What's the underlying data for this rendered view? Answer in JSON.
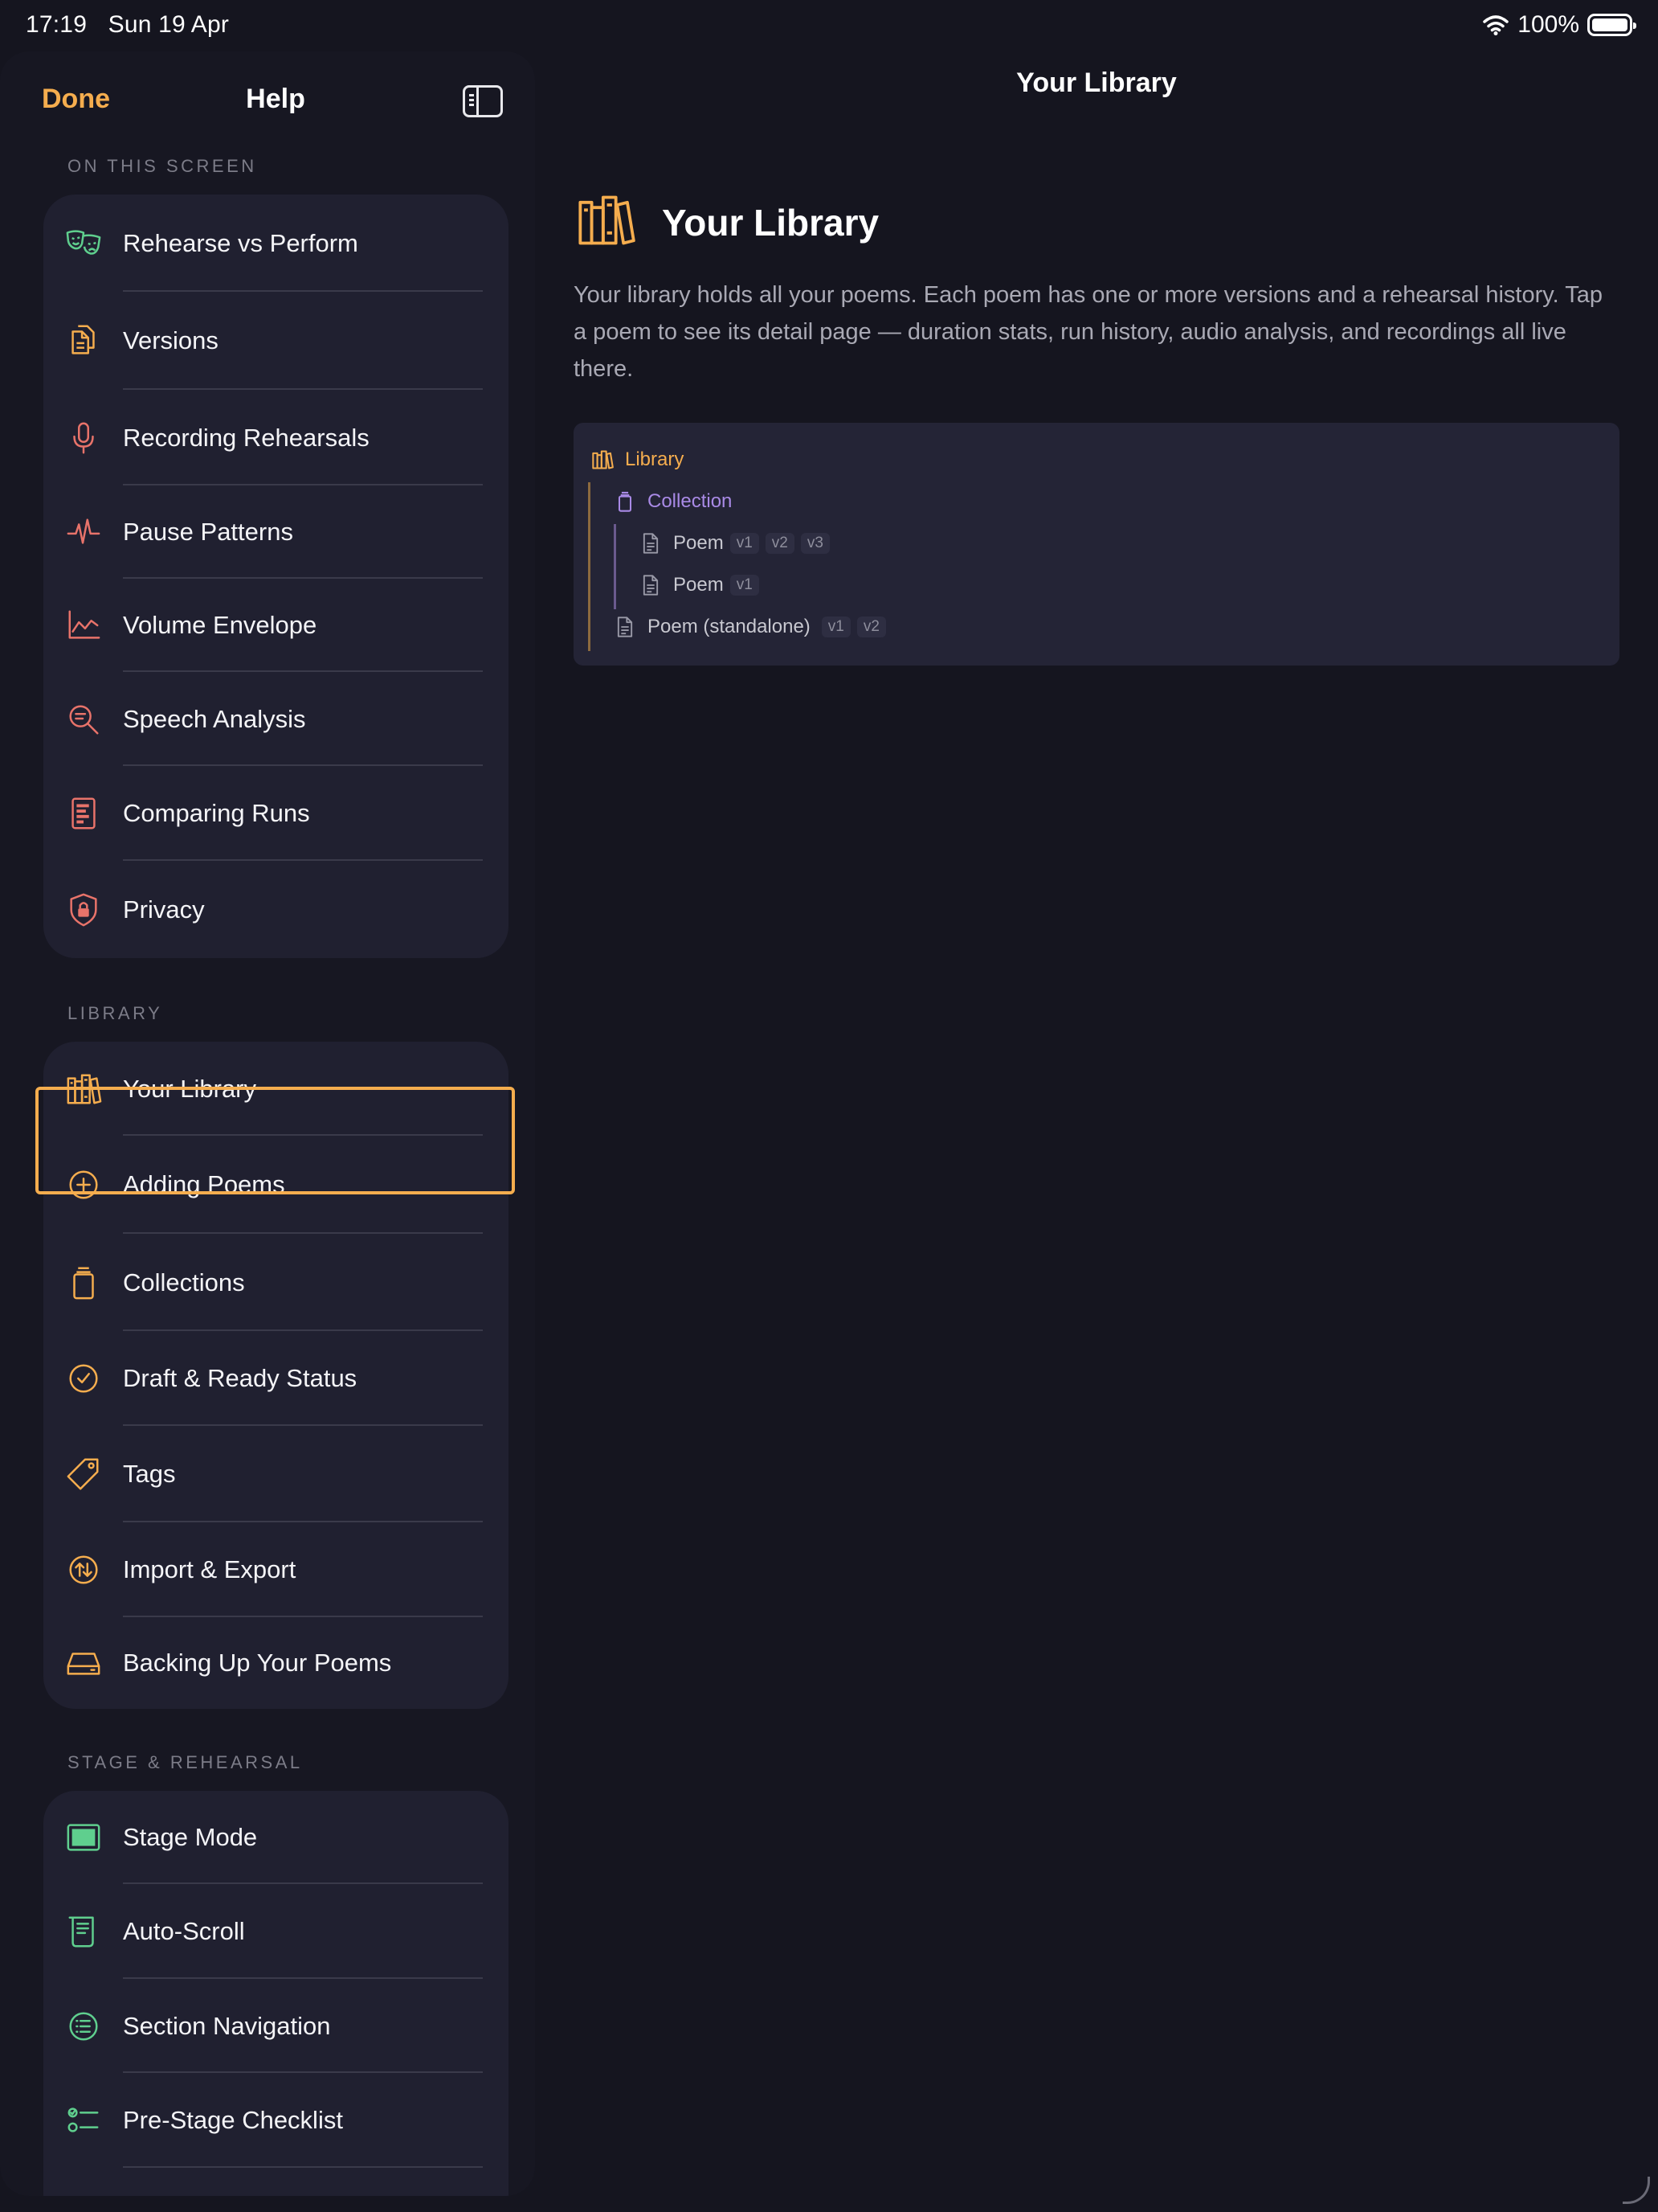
{
  "status_bar": {
    "time": "17:19",
    "date": "Sun 19 Apr",
    "battery": "100%"
  },
  "sidebar": {
    "done_label": "Done",
    "title": "Help",
    "sections": [
      {
        "label": "ON THIS SCREEN",
        "items": [
          {
            "label": "Rehearse vs Perform",
            "icon": "theater-masks-icon"
          },
          {
            "label": "Versions",
            "icon": "documents-icon"
          },
          {
            "label": "Recording Rehearsals",
            "icon": "microphone-icon"
          },
          {
            "label": "Pause Patterns",
            "icon": "waveform-icon"
          },
          {
            "label": "Volume Envelope",
            "icon": "line-chart-icon"
          },
          {
            "label": "Speech Analysis",
            "icon": "magnify-text-icon"
          },
          {
            "label": "Comparing Runs",
            "icon": "comparison-doc-icon"
          },
          {
            "label": "Privacy",
            "icon": "lock-shield-icon"
          }
        ]
      },
      {
        "label": "LIBRARY",
        "items": [
          {
            "label": "Your Library",
            "icon": "books-icon"
          },
          {
            "label": "Adding Poems",
            "icon": "plus-circle-icon"
          },
          {
            "label": "Collections",
            "icon": "jar-icon"
          },
          {
            "label": "Draft & Ready Status",
            "icon": "check-circle-icon"
          },
          {
            "label": "Tags",
            "icon": "tag-icon"
          },
          {
            "label": "Import & Export",
            "icon": "arrows-updown-circle-icon"
          },
          {
            "label": "Backing Up Your Poems",
            "icon": "drive-icon"
          }
        ]
      },
      {
        "label": "STAGE & REHEARSAL",
        "items": [
          {
            "label": "Stage Mode",
            "icon": "display-icon"
          },
          {
            "label": "Auto-Scroll",
            "icon": "scroll-icon"
          },
          {
            "label": "Section Navigation",
            "icon": "list-circle-icon"
          },
          {
            "label": "Pre-Stage Checklist",
            "icon": "checklist-icon"
          }
        ]
      }
    ],
    "selected_item": "Your Library"
  },
  "main": {
    "nav_title": "Your Library",
    "heading": "Your Library",
    "description": "Your library holds all your poems. Each poem has one or more versions and a rehearsal history. Tap a poem to see its detail page — duration stats, run history, audio analysis, and recordings all live there.",
    "tree": {
      "root": "Library",
      "collection": "Collection",
      "poem_label": "Poem",
      "poem1_versions": [
        "v1",
        "v2",
        "v3"
      ],
      "poem2_versions": [
        "v1"
      ],
      "standalone": "Poem (standalone)",
      "standalone_versions": [
        "v1",
        "v2"
      ]
    }
  },
  "colors": {
    "accent": "#f5ad4e",
    "screen_icons": "#e8736a",
    "stage_icons": "#5fcf8e",
    "collection": "#a98ae6",
    "background": "#15151f",
    "group_bg": "#202030"
  }
}
